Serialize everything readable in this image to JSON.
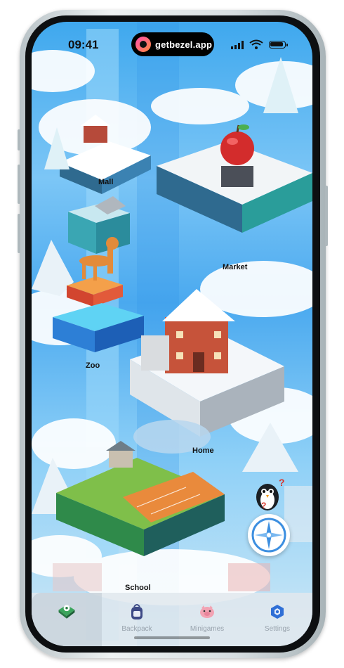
{
  "status_bar": {
    "time": "09:41",
    "pill_text": "getbezel.app"
  },
  "map": {
    "locations": [
      "Mall",
      "Market",
      "Zoo",
      "Home",
      "School"
    ]
  },
  "tab_bar": {
    "tabs": [
      {
        "label": "",
        "icon": "map-pin-icon",
        "active": true
      },
      {
        "label": "Backpack",
        "icon": "backpack-icon",
        "active": false
      },
      {
        "label": "Minigames",
        "icon": "pig-icon",
        "active": false
      },
      {
        "label": "Settings",
        "icon": "hexagon-gear-icon",
        "active": false
      }
    ]
  },
  "colors": {
    "sky": "#4aa9ef",
    "accent_orange": "#e87a3a",
    "compass_blue": "#3d8fe0"
  }
}
